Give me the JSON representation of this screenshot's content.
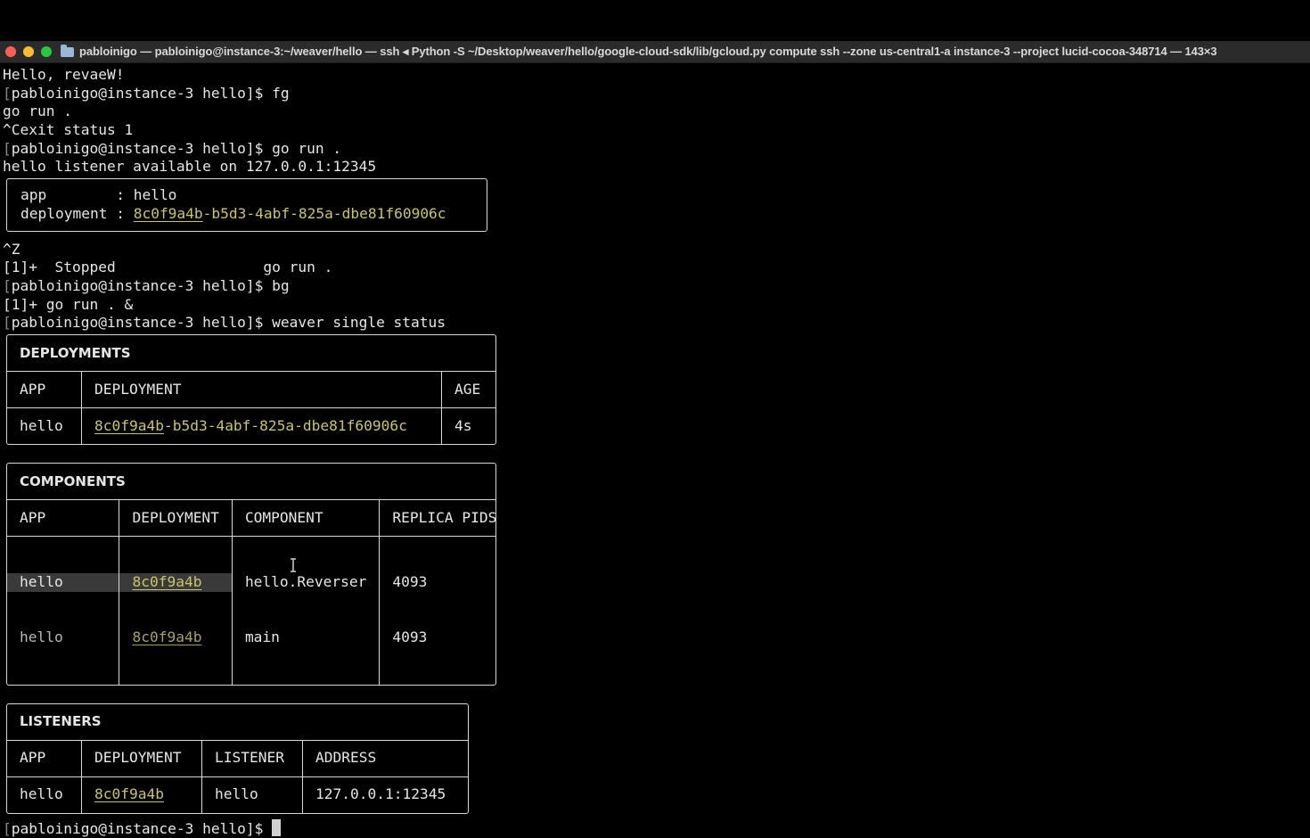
{
  "window": {
    "title": "pabloinigo — pabloinigo@instance-3:~/weaver/hello — ssh ◂ Python -S ~/Desktop/weaver/hello/google-cloud-sdk/lib/gcloud.py compute ssh --zone us-central1-a instance-3 --project lucid-cocoa-348714 — 143×3"
  },
  "lines_top": [
    "Hello, revaeW!",
    "pabloinigo@instance-3 hello]$ fg",
    "go run .",
    "^Cexit status 1",
    "pabloinigo@instance-3 hello]$ go run .",
    "hello listener available on 127.0.0.1:12345"
  ],
  "info_box": {
    "app_key": "app        : ",
    "app_value": "hello",
    "deployment_key": "deployment : ",
    "deployment_short": "8c0f9a4b",
    "deployment_rest": "-b5d3-4abf-825a-dbe81f60906c"
  },
  "lines_mid": [
    "^Z",
    "[1]+  Stopped                 go run .",
    "pabloinigo@instance-3 hello]$ bg",
    "[1]+ go run . &",
    "pabloinigo@instance-3 hello]$ weaver single status"
  ],
  "deployments": {
    "title": "DEPLOYMENTS",
    "headers": [
      "APP",
      "DEPLOYMENT",
      "AGE"
    ],
    "row": {
      "app": "hello",
      "dep_short": "8c0f9a4b",
      "dep_rest": "-b5d3-4abf-825a-dbe81f60906c",
      "age": "4s"
    }
  },
  "components": {
    "title": "COMPONENTS",
    "headers": [
      "APP",
      "DEPLOYMENT",
      "COMPONENT",
      "REPLICA PIDS"
    ],
    "rows": [
      {
        "app": "hello",
        "dep": "8c0f9a4b",
        "component": "hello.Reverser",
        "pids": "4093"
      },
      {
        "app": "hello",
        "dep": "8c0f9a4b",
        "component": "main",
        "pids": "4093"
      }
    ]
  },
  "listeners": {
    "title": "LISTENERS",
    "headers": [
      "APP",
      "DEPLOYMENT",
      "LISTENER",
      "ADDRESS"
    ],
    "row": {
      "app": "hello",
      "dep": "8c0f9a4b",
      "listener": "hello",
      "address": "127.0.0.1:12345"
    }
  },
  "prompt": "pabloinigo@instance-3 hello]$ "
}
